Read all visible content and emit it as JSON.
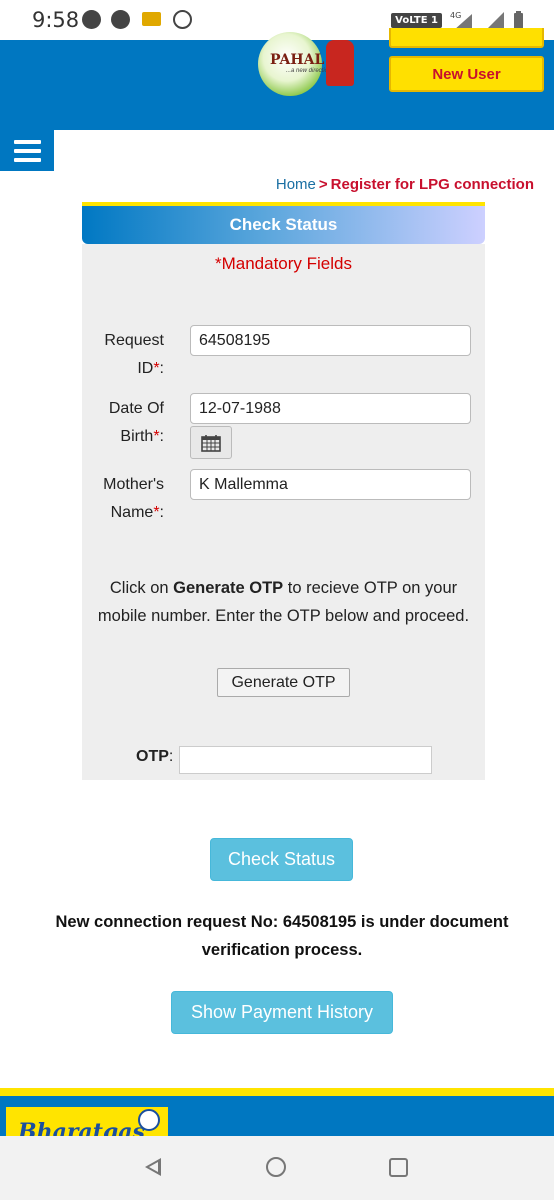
{
  "status_bar": {
    "time": "9:58",
    "network_badge": "VoLTE 1",
    "network_type": "4G"
  },
  "header": {
    "logo_text": "PAHAL",
    "logo_subtext": "...a new direction",
    "top_button_label": "",
    "new_user_label": "New User"
  },
  "breadcrumb": {
    "home": "Home",
    "separator": ">",
    "current": "Register for LPG connection"
  },
  "form": {
    "title": "Check Status",
    "mandatory_note": "*Mandatory Fields",
    "request_id": {
      "label_1": "Request",
      "label_2": "ID",
      "required_mark": "*",
      "colon": ":",
      "value": "64508195"
    },
    "dob": {
      "label_1": "Date Of",
      "label_2": "Birth",
      "required_mark": "*",
      "colon": ":",
      "value": "12-07-1988"
    },
    "mother_name": {
      "label_1": "Mother's",
      "label_2": "Name",
      "required_mark": "*",
      "colon": ":",
      "value": "K Mallemma"
    },
    "info_prefix": "Click on ",
    "info_bold": "Generate OTP",
    "info_suffix": " to recieve OTP on your mobile number. Enter the OTP below and proceed.",
    "generate_otp_label": "Generate OTP",
    "otp_label": "OTP",
    "otp_colon": ":",
    "otp_value": ""
  },
  "actions": {
    "check_status_label": "Check Status",
    "show_payment_history_label": "Show Payment History"
  },
  "result_message": "New connection request No: 64508195 is under document verification process.",
  "footer": {
    "logo_text": "Bharatgas"
  },
  "colors": {
    "header_blue": "#0077c1",
    "accent_yellow": "#ffe400",
    "button_blue": "#5bc0de",
    "required_red": "#d40000"
  }
}
